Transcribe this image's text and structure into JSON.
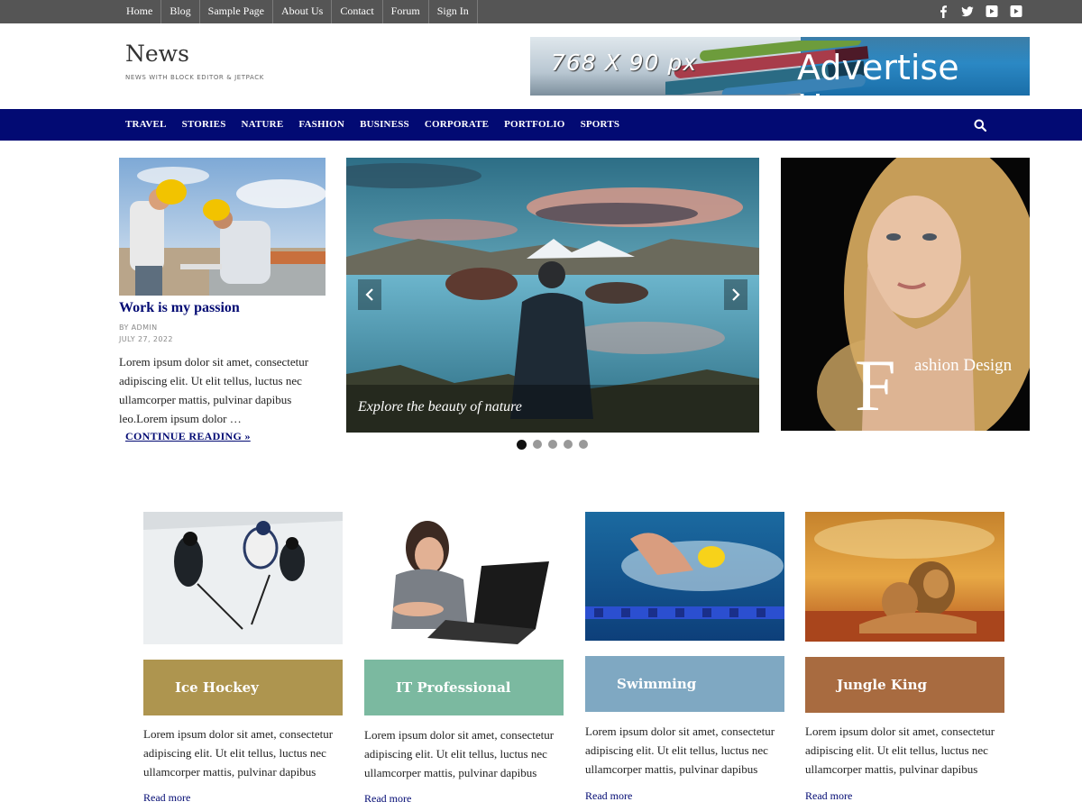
{
  "topnav": {
    "links": [
      "Home",
      "Blog",
      "Sample Page",
      "About Us",
      "Contact",
      "Forum",
      "Sign In"
    ],
    "social_icons": [
      "facebook-icon",
      "twitter-icon",
      "youtube-icon",
      "youtube-icon"
    ]
  },
  "header": {
    "site_title": "News",
    "tagline": "News with Block Editor & Jetpack",
    "ad_size": "768 X 90 px",
    "ad_text": "Advertise Here"
  },
  "mainnav": {
    "links": [
      "TRAVEL",
      "STORIES",
      "NATURE",
      "FASHION",
      "BUSINESS",
      "CORPORATE",
      "PORTFOLIO",
      "SPORTS"
    ],
    "search_icon": "search-icon"
  },
  "featured": {
    "title": "Work is my passion",
    "author": "BY ADMIN",
    "date": "JULY 27, 2022",
    "excerpt": "Lorem ipsum dolor sit amet, consectetur adipiscing elit. Ut elit tellus, luctus nec ullamcorper mattis, pulvinar dapibus leo.Lorem ipsum dolor …",
    "continue_label": "CONTINUE READING »"
  },
  "slider": {
    "caption": "Explore the beauty of nature",
    "slide_count": 5,
    "active_index": 0
  },
  "promo": {
    "big_letter": "F",
    "text": "ashion Design"
  },
  "cards": [
    {
      "label": "Ice Hockey",
      "color": "#ae954f",
      "text": "Lorem ipsum dolor sit amet, consectetur adipiscing elit. Ut elit tellus, luctus nec ullamcorper mattis, pulvinar dapibus",
      "more": "Read more"
    },
    {
      "label": "IT Professional",
      "color": "#7bb9a0",
      "text": "Lorem ipsum dolor sit amet, consectetur adipiscing elit. Ut elit tellus, luctus nec ullamcorper mattis, pulvinar dapibus",
      "more": "Read more"
    },
    {
      "label": "Swimming",
      "color": "#7fa8c2",
      "text": "Lorem ipsum dolor sit amet, consectetur adipiscing elit. Ut elit tellus, luctus nec ullamcorper mattis, pulvinar dapibus",
      "more": "Read more"
    },
    {
      "label": "Jungle King",
      "color": "#a86b40",
      "text": "Lorem ipsum dolor sit amet, consectetur adipiscing elit. Ut elit tellus, luctus nec ullamcorper mattis, pulvinar dapibus",
      "more": "Read more"
    }
  ],
  "colors": {
    "topbar": "#555555",
    "mainnav": "#020a73",
    "link": "#020a73"
  }
}
